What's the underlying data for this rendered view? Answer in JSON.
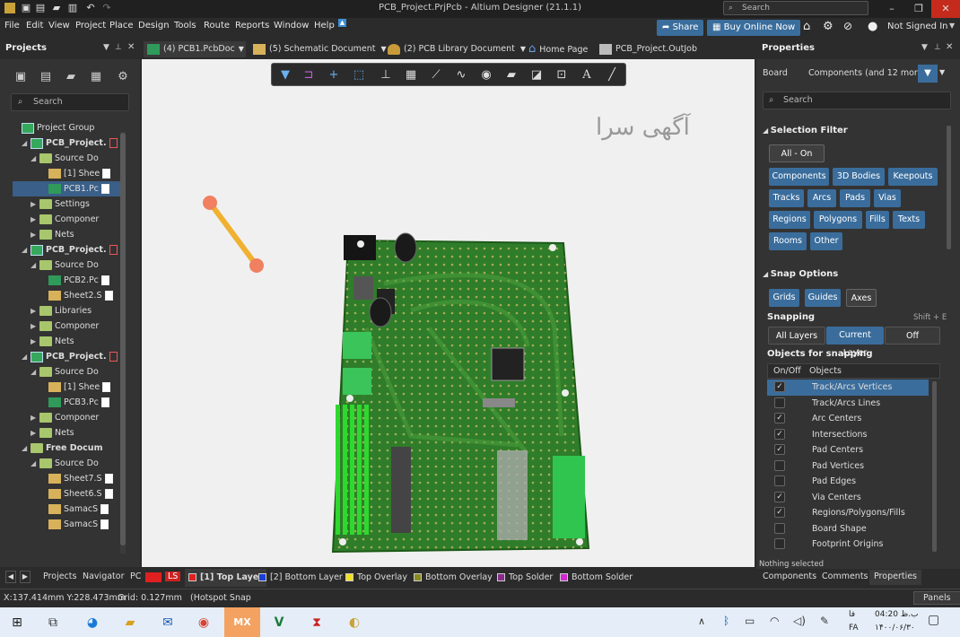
{
  "window": {
    "title": "PCB_Project.PrjPcb - Altium Designer (21.1.1)",
    "search_placeholder": "Search"
  },
  "menu": {
    "items": [
      "File",
      "Edit",
      "View",
      "Project",
      "Place",
      "Design",
      "Tools",
      "Route",
      "Reports",
      "Window",
      "Help"
    ],
    "share": "Share",
    "buy": "Buy Online Now",
    "user": "Not Signed In"
  },
  "tabs": [
    {
      "label": "(4) PCB1.PcbDoc",
      "active": true
    },
    {
      "label": "(5) Schematic Document"
    },
    {
      "label": "(2) PCB Library Document"
    },
    {
      "label": "Home Page"
    },
    {
      "label": "PCB_Project.OutJob"
    }
  ],
  "projects": {
    "title": "Projects",
    "search_placeholder": "Search",
    "tree": [
      {
        "label": "Project Group",
        "level": 0,
        "kind": "group"
      },
      {
        "label": "PCB_Project.",
        "level": 1,
        "kind": "project",
        "bold": true
      },
      {
        "label": "Source Do",
        "level": 2,
        "kind": "folder"
      },
      {
        "label": "[1] Shee",
        "level": 3,
        "kind": "sch"
      },
      {
        "label": "PCB1.Pc",
        "level": 3,
        "kind": "pcb",
        "selected": true
      },
      {
        "label": "Settings",
        "level": 2,
        "kind": "folder",
        "collapsed": true
      },
      {
        "label": "Componer",
        "level": 2,
        "kind": "folder",
        "collapsed": true
      },
      {
        "label": "Nets",
        "level": 2,
        "kind": "folder",
        "collapsed": true
      },
      {
        "label": "PCB_Project.",
        "level": 1,
        "kind": "project",
        "bold": true
      },
      {
        "label": "Source Do",
        "level": 2,
        "kind": "folder"
      },
      {
        "label": "PCB2.Pc",
        "level": 3,
        "kind": "pcb"
      },
      {
        "label": "Sheet2.S",
        "level": 3,
        "kind": "sch"
      },
      {
        "label": "Libraries",
        "level": 2,
        "kind": "folder",
        "collapsed": true
      },
      {
        "label": "Componer",
        "level": 2,
        "kind": "folder",
        "collapsed": true
      },
      {
        "label": "Nets",
        "level": 2,
        "kind": "folder",
        "collapsed": true
      },
      {
        "label": "PCB_Project.",
        "level": 1,
        "kind": "project",
        "bold": true
      },
      {
        "label": "Source Do",
        "level": 2,
        "kind": "folder"
      },
      {
        "label": "[1] Shee",
        "level": 3,
        "kind": "sch"
      },
      {
        "label": "PCB3.Pc",
        "level": 3,
        "kind": "pcb"
      },
      {
        "label": "Componer",
        "level": 2,
        "kind": "folder",
        "collapsed": true
      },
      {
        "label": "Nets",
        "level": 2,
        "kind": "folder",
        "collapsed": true
      },
      {
        "label": "Free Docum",
        "level": 1,
        "kind": "folder",
        "bold": true
      },
      {
        "label": "Source Do",
        "level": 2,
        "kind": "folder"
      },
      {
        "label": "Sheet7.S",
        "level": 3,
        "kind": "sch"
      },
      {
        "label": "Sheet6.S",
        "level": 3,
        "kind": "sch"
      },
      {
        "label": "SamacS",
        "level": 3,
        "kind": "sch"
      },
      {
        "label": "SamacS",
        "level": 3,
        "kind": "sch"
      }
    ]
  },
  "canvas": {
    "watermark": "آگهی سرا"
  },
  "properties": {
    "title": "Properties",
    "board": "Board",
    "components": "Components (and 12 more)",
    "search_placeholder": "Search",
    "selection_filter": "Selection Filter",
    "all_on": "All - On",
    "filters": [
      "Components",
      "3D Bodies",
      "Keepouts",
      "Tracks",
      "Arcs",
      "Pads",
      "Vias",
      "Regions",
      "Polygons",
      "Fills",
      "Texts",
      "Rooms",
      "Other"
    ],
    "snap_options": "Snap Options",
    "snap_modes": [
      "Grids",
      "Guides",
      "Axes"
    ],
    "snapping": "Snapping",
    "snapping_shortcut": "Shift + E",
    "snap_layers": [
      "All Layers",
      "Current Layer",
      "Off"
    ],
    "objects_for_snapping": "Objects for snapping",
    "col_onoff": "On/Off",
    "col_objects": "Objects",
    "objects": [
      {
        "label": "Track/Arcs Vertices",
        "on": true,
        "selected": true
      },
      {
        "label": "Track/Arcs Lines",
        "on": false
      },
      {
        "label": "Arc Centers",
        "on": true
      },
      {
        "label": "Intersections",
        "on": true
      },
      {
        "label": "Pad Centers",
        "on": true
      },
      {
        "label": "Pad Vertices",
        "on": false
      },
      {
        "label": "Pad Edges",
        "on": false
      },
      {
        "label": "Via Centers",
        "on": true
      },
      {
        "label": "Regions/Polygons/Fills",
        "on": true
      },
      {
        "label": "Board Shape",
        "on": false
      },
      {
        "label": "Footprint Origins",
        "on": false
      }
    ],
    "nothing_selected": "Nothing selected",
    "bottom_tabs": [
      "Components",
      "Comments",
      "Properties"
    ]
  },
  "layerbar": {
    "panel_tabs": [
      "Projects",
      "Navigator",
      "PC"
    ],
    "ls": "LS",
    "layers": [
      {
        "label": "[1] Top Layer",
        "color": "#e02020",
        "active": true
      },
      {
        "label": "[2] Bottom Layer",
        "color": "#1a3fd8"
      },
      {
        "label": "Top Overlay",
        "color": "#f0e020"
      },
      {
        "label": "Bottom Overlay",
        "color": "#8a8a22"
      },
      {
        "label": "Top Solder",
        "color": "#8a2a8a"
      },
      {
        "label": "Bottom Solder",
        "color": "#d02ad0"
      }
    ]
  },
  "status": {
    "coords": "X:137.414mm Y:228.473mm",
    "grid": "Grid: 0.127mm",
    "hotspot": "(Hotspot Snap",
    "panels": "Panels"
  },
  "taskbar": {
    "time": "04:20 ب.ظ",
    "date": "۱۴۰۰/۰۶/۳۰",
    "lang": "FA",
    "lang2": "فا"
  }
}
